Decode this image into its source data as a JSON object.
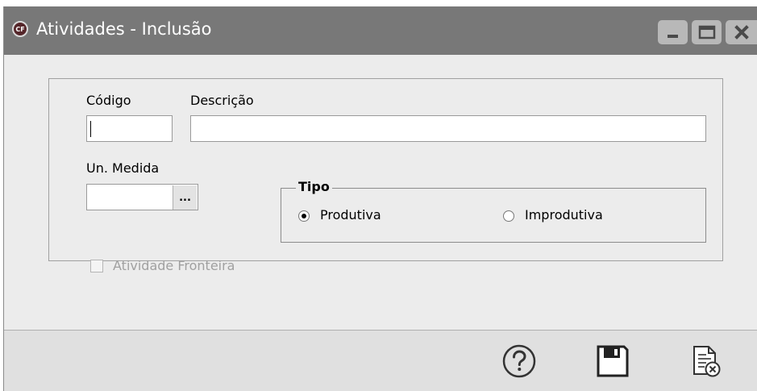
{
  "window": {
    "title": "Atividades - Inclusão",
    "app_icon_text": "CF",
    "buttons": [
      "minimize-icon",
      "maximize-icon",
      "close-icon"
    ]
  },
  "form": {
    "codigo_label": "Código",
    "codigo_value": "",
    "descricao_label": "Descrição",
    "descricao_value": "",
    "un_medida_label": "Un. Medida",
    "un_medida_value": "",
    "lookup_button_label": "...",
    "tipo": {
      "legend": "Tipo",
      "options": [
        {
          "label": "Produtiva",
          "selected": true
        },
        {
          "label": "Improdutiva",
          "selected": false
        }
      ]
    },
    "atividade_fronteira_label": "Atividade Fronteira",
    "atividade_fronteira_checked": false,
    "atividade_fronteira_enabled": false
  },
  "toolbar": {
    "buttons": [
      "help-icon",
      "save-icon",
      "cancel-document-icon"
    ]
  },
  "colors": {
    "titlebar": "#787878",
    "window_bg": "#ececec",
    "bottom_bar": "#e0e0e0"
  }
}
